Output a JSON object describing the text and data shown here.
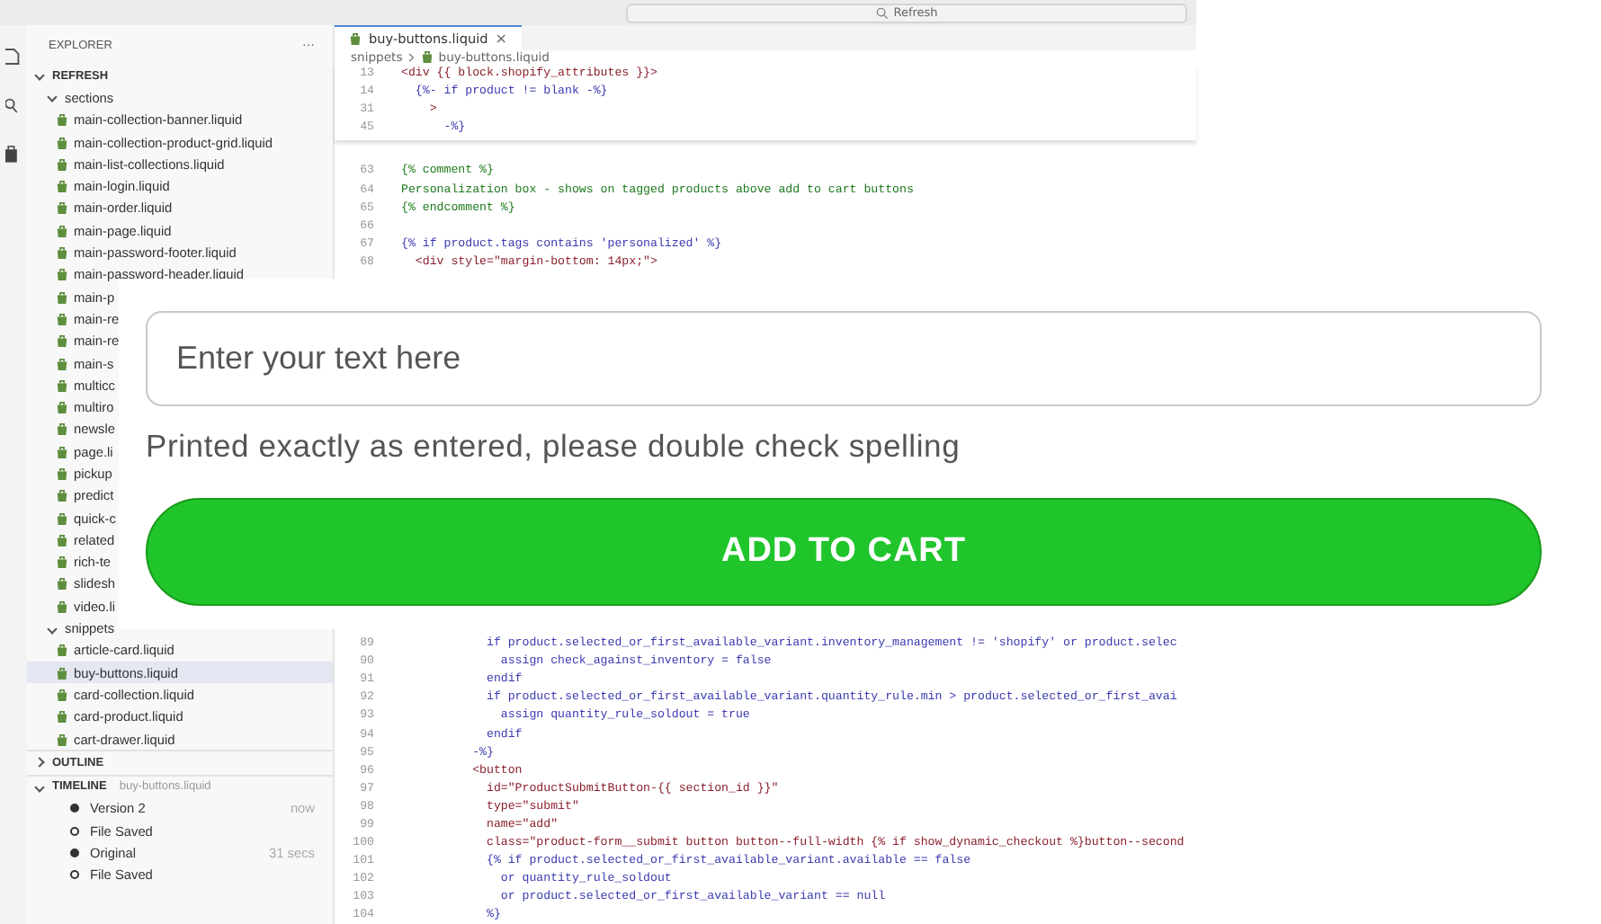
{
  "title_bar": {
    "search_label": "Refresh"
  },
  "sidebar": {
    "title": "EXPLORER",
    "more": "···",
    "tree": [
      {
        "label": "REFRESH",
        "expanded": true,
        "children": [
          {
            "label": "sections",
            "expanded": true,
            "children": [
              {
                "label": "main-collection-banner.liquid",
                "selected": false
              },
              {
                "label": "main-collection-product-grid.liquid",
                "selected": false
              },
              {
                "label": "main-list-collections.liquid",
                "selected": false
              },
              {
                "label": "main-login.liquid",
                "selected": false
              },
              {
                "label": "main-order.liquid",
                "selected": false
              },
              {
                "label": "main-page.liquid",
                "selected": false
              },
              {
                "label": "main-password-footer.liquid",
                "selected": false
              },
              {
                "label": "main-password-header.liquid",
                "selected": false
              },
              {
                "label": "main-p",
                "selected": false
              },
              {
                "label": "main-re",
                "selected": false
              },
              {
                "label": "main-re",
                "selected": false
              },
              {
                "label": "main-s",
                "selected": false
              },
              {
                "label": "multicc",
                "selected": false
              },
              {
                "label": "multiro",
                "selected": false
              },
              {
                "label": "newsle",
                "selected": false
              },
              {
                "label": "page.li",
                "selected": false
              },
              {
                "label": "pickup",
                "selected": false
              },
              {
                "label": "predict",
                "selected": false
              },
              {
                "label": "quick-c",
                "selected": false
              },
              {
                "label": "related",
                "selected": false
              },
              {
                "label": "rich-te",
                "selected": false
              },
              {
                "label": "slidesh",
                "selected": false
              },
              {
                "label": "video.li",
                "selected": false
              }
            ]
          },
          {
            "label": "snippets",
            "expanded": true,
            "children": [
              {
                "label": "article-card.liquid",
                "selected": false
              },
              {
                "label": "buy-buttons.liquid",
                "selected": true
              },
              {
                "label": "card-collection.liquid",
                "selected": false
              },
              {
                "label": "card-product.liquid",
                "selected": false
              },
              {
                "label": "cart-drawer.liquid",
                "selected": false
              }
            ]
          }
        ]
      }
    ],
    "outline": {
      "label": "OUTLINE",
      "expanded": false
    },
    "timeline": {
      "label": "TIMELINE",
      "file": "buy-buttons.liquid",
      "expanded": true,
      "items": [
        {
          "label": "Version 2",
          "time": "now",
          "kind": "version"
        },
        {
          "label": "File Saved",
          "kind": "save"
        },
        {
          "label": "Original",
          "time": "31 secs",
          "kind": "version"
        },
        {
          "label": "File Saved",
          "kind": "save"
        }
      ]
    }
  },
  "editor": {
    "tab": {
      "label": "buy-buttons.liquid",
      "close": "×",
      "selected": true
    },
    "breadcrumb": [
      "snippets",
      "buy-buttons.liquid"
    ],
    "sticky_lines": [
      {
        "number": "13",
        "text": "<div {{ block.shopify_attributes }}>",
        "kind": "tag"
      },
      {
        "number": "14",
        "text": "  {%- if product != blank -%}",
        "kind": "liquid"
      },
      {
        "number": "31",
        "text": "    >",
        "kind": "tag"
      },
      {
        "number": "45",
        "text": "      -%}",
        "kind": "liquid"
      }
    ],
    "lines_top": [
      {
        "number": "63",
        "text": "{% comment %}",
        "kind": "comment"
      },
      {
        "number": "64",
        "text": "Personalization box - shows on tagged products above add to cart buttons",
        "kind": "comment"
      },
      {
        "number": "65",
        "text": "{% endcomment %}",
        "kind": "comment"
      },
      {
        "number": "66"
      },
      {
        "number": "67",
        "text": "{% if product.tags contains 'personalized' %}",
        "kind": "liquid"
      },
      {
        "number": "68",
        "text": "  <div style=\"margin-bottom: 14px;\">",
        "kind": "tag"
      }
    ],
    "lines_bottom": [
      {
        "number": "89",
        "text": "            if product.selected_or_first_available_variant.inventory_management != 'shopify' or product.selec",
        "kind": "liquid"
      },
      {
        "number": "90",
        "text": "              assign check_against_inventory = false",
        "kind": "liquid"
      },
      {
        "number": "91",
        "text": "            endif",
        "kind": "liquid"
      },
      {
        "number": "92",
        "text": "            if product.selected_or_first_available_variant.quantity_rule.min > product.selected_or_first_avai",
        "kind": "liquid"
      },
      {
        "number": "93",
        "text": "              assign quantity_rule_soldout = true",
        "kind": "liquid"
      },
      {
        "number": "94",
        "text": "            endif",
        "kind": "liquid"
      },
      {
        "number": "95",
        "text": "          -%}",
        "kind": "liquid"
      },
      {
        "number": "96",
        "text": "          <button",
        "kind": "tag"
      },
      {
        "number": "97",
        "text": "            id=\"ProductSubmitButton-{{ section_id }}\"",
        "kind": "tag"
      },
      {
        "number": "98",
        "text": "            type=\"submit\"",
        "kind": "tag"
      },
      {
        "number": "99",
        "text": "            name=\"add\"",
        "kind": "tag"
      },
      {
        "number": "100",
        "text": "            class=\"product-form__submit button button--full-width {% if show_dynamic_checkout %}button--second",
        "kind": "tag"
      },
      {
        "number": "101",
        "text": "            {% if product.selected_or_first_available_variant.available == false",
        "kind": "liquid"
      },
      {
        "number": "102",
        "text": "              or quantity_rule_soldout",
        "kind": "liquid"
      },
      {
        "number": "103",
        "text": "              or product.selected_or_first_available_variant == null",
        "kind": "liquid"
      },
      {
        "number": "104",
        "text": "            %}",
        "kind": "liquid"
      }
    ]
  },
  "preview": {
    "input": {
      "placeholder": "Enter your text here"
    },
    "note": "Printed exactly as entered, please double check spelling",
    "button": "ADD TO CART"
  }
}
